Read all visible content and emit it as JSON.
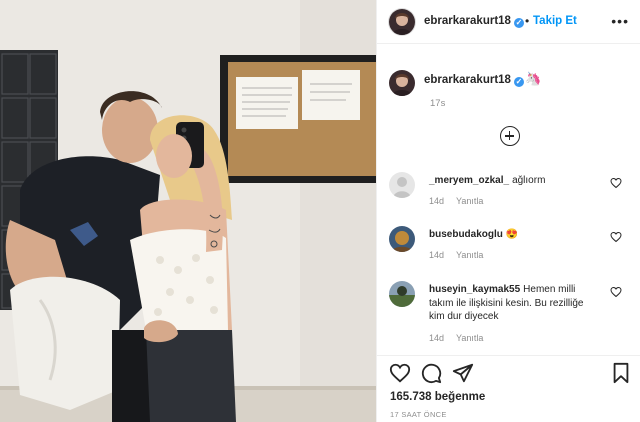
{
  "post": {
    "username": "ebrarkarakurt18",
    "verified_mark": "✓",
    "separator": "•",
    "follow_label": "Takip Et",
    "more_label": "•••",
    "caption_emoji": "🦄",
    "caption_time": "17s",
    "likes": "165.738 beğenme",
    "posted_ago": "17 SAAT ÖNCE"
  },
  "comments": [
    {
      "username": "_meryem_ozkal_",
      "text": "ağlıorm",
      "time": "14d",
      "reply_label": "Yanıtla",
      "avatar_color": "#d9d9d9"
    },
    {
      "username": "busebudakoglu",
      "text": "😍",
      "time": "14d",
      "reply_label": "Yanıtla",
      "avatar_color": "#c08a3a"
    },
    {
      "username": "huseyin_kaymak55",
      "text": "Hemen milli takım ile ilişkisini kesin. Bu rezilliğe kim dur diyecek",
      "time": "14d",
      "reply_label": "Yanıtla",
      "avatar_color": "#4f6b3a"
    }
  ],
  "icons": {
    "header_avatar": "profile-avatar-icon",
    "verified": "verified-badge-icon",
    "load_more": "plus-circle-icon",
    "like": "heart-icon",
    "comment": "comment-bubble-icon",
    "share": "paper-plane-icon",
    "save": "bookmark-icon"
  },
  "colors": {
    "accent": "#0095f6",
    "verified": "#3897f0",
    "text": "#262626",
    "muted": "#8e8e8e",
    "border": "#efefef"
  }
}
